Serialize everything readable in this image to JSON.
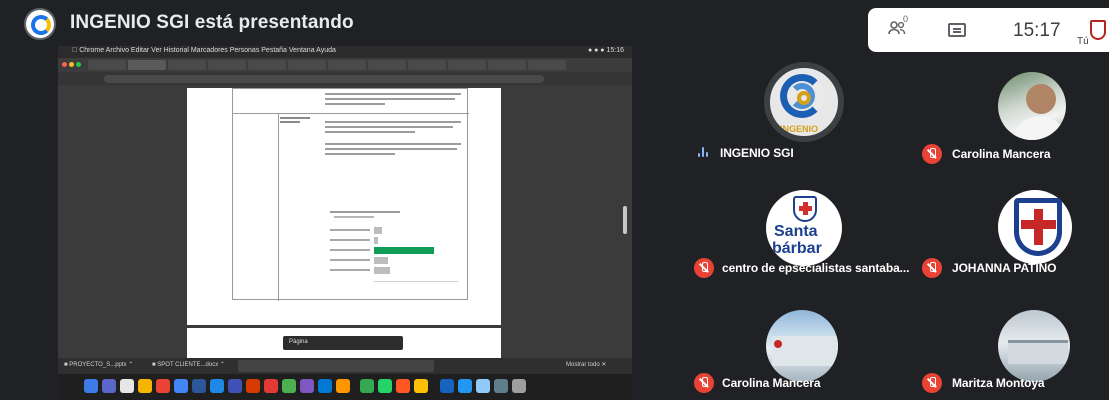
{
  "presenting": {
    "title": "INGENIO SGI está presentando"
  },
  "controls": {
    "people_icon": "people-icon",
    "people_count": "0",
    "chat_icon": "chat-icon",
    "time": "15:17",
    "self_label": "Tú"
  },
  "shared_screen": {
    "apps": [
      "Chrome",
      "Google Docs"
    ],
    "page_label": "Página"
  },
  "participants": [
    {
      "name": "INGENIO SGI",
      "muted": false,
      "speaking": true,
      "avatar": "INGENIO"
    },
    {
      "name": "Carolina Mancera",
      "muted": true,
      "avatar": "photo"
    },
    {
      "name": "centro de epsecialistas santaba...",
      "muted": true,
      "avatar": "Santa Bárbara",
      "avatar_text_1": "Santa",
      "avatar_text_2": "bárbar"
    },
    {
      "name": "JOHANNA PATIÑO",
      "muted": true,
      "avatar": "shield"
    },
    {
      "name": "Carolina Mancera",
      "muted": true,
      "avatar": "photo"
    },
    {
      "name": "Maritza Montoya",
      "muted": true,
      "avatar": "photo"
    }
  ],
  "colors": {
    "background": "#202124",
    "mic_off": "#ea4335",
    "speaking": "#8ab4f8",
    "green_bar": "#0f9d58"
  }
}
